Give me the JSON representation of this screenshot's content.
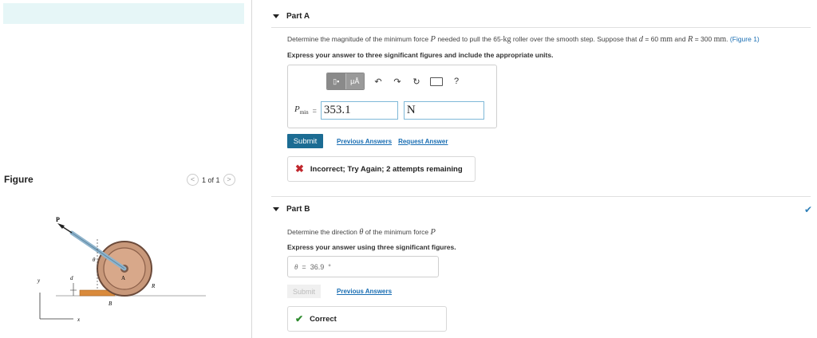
{
  "left": {
    "figure_label": "Figure",
    "pager": {
      "text": "1 of 1",
      "prev": "<",
      "next": ">"
    },
    "diagram": {
      "labels": {
        "P": "P",
        "theta": "θ",
        "d": "d",
        "A": "A",
        "B": "B",
        "R": "R",
        "y": "y",
        "x": "x"
      }
    }
  },
  "partA": {
    "title": "Part A",
    "question": {
      "t1": "Determine the magnitude of the minimum force ",
      "var_P": "P",
      "t2": " needed to pull the 65-",
      "unit_kg": "kg",
      "t3": " roller over the smooth step. Suppose that ",
      "var_d": "d",
      "t4": " = 60  ",
      "unit_mm1": "mm",
      "t5": " and ",
      "var_R": "R",
      "t6": " = 300  ",
      "unit_mm2": "mm",
      "t7": ".",
      "figure_link": "(Figure 1)"
    },
    "instruction": "Express your answer to three significant figures and include the appropriate units.",
    "toolbar": {
      "templates": "▯▪",
      "units": "μÅ",
      "undo": "↶",
      "redo": "↷",
      "reset": "↻",
      "help": "?"
    },
    "answer": {
      "label": "P",
      "label_sub": "min",
      "equals": "=",
      "value": "353.1",
      "unit": "N"
    },
    "submit": "Submit",
    "links": {
      "previous": "Previous Answers",
      "request": "Request Answer"
    },
    "feedback": {
      "icon": "✖",
      "text": "Incorrect; Try Again; 2 attempts remaining"
    }
  },
  "partB": {
    "title": "Part B",
    "question": {
      "t1": "Determine the direction ",
      "var_theta": "θ",
      "t2": " of the minimum force ",
      "var_P": "P"
    },
    "instruction": "Express your answer using three significant figures.",
    "answer": {
      "label": "θ",
      "equals": "=",
      "value": "36.9",
      "unit": "°"
    },
    "submit": "Submit",
    "link": "Previous Answers",
    "feedback": {
      "icon": "✔",
      "text": "Correct"
    },
    "status_icon": "✔"
  },
  "colors": {
    "submit_bg": "#1c6c93",
    "link": "#1a6eb3",
    "banner": "#e6f6f7",
    "incorrect": "#c0272d",
    "correct": "#2e8b2e",
    "roller": "#c8987a",
    "step": "#d98a3c"
  }
}
